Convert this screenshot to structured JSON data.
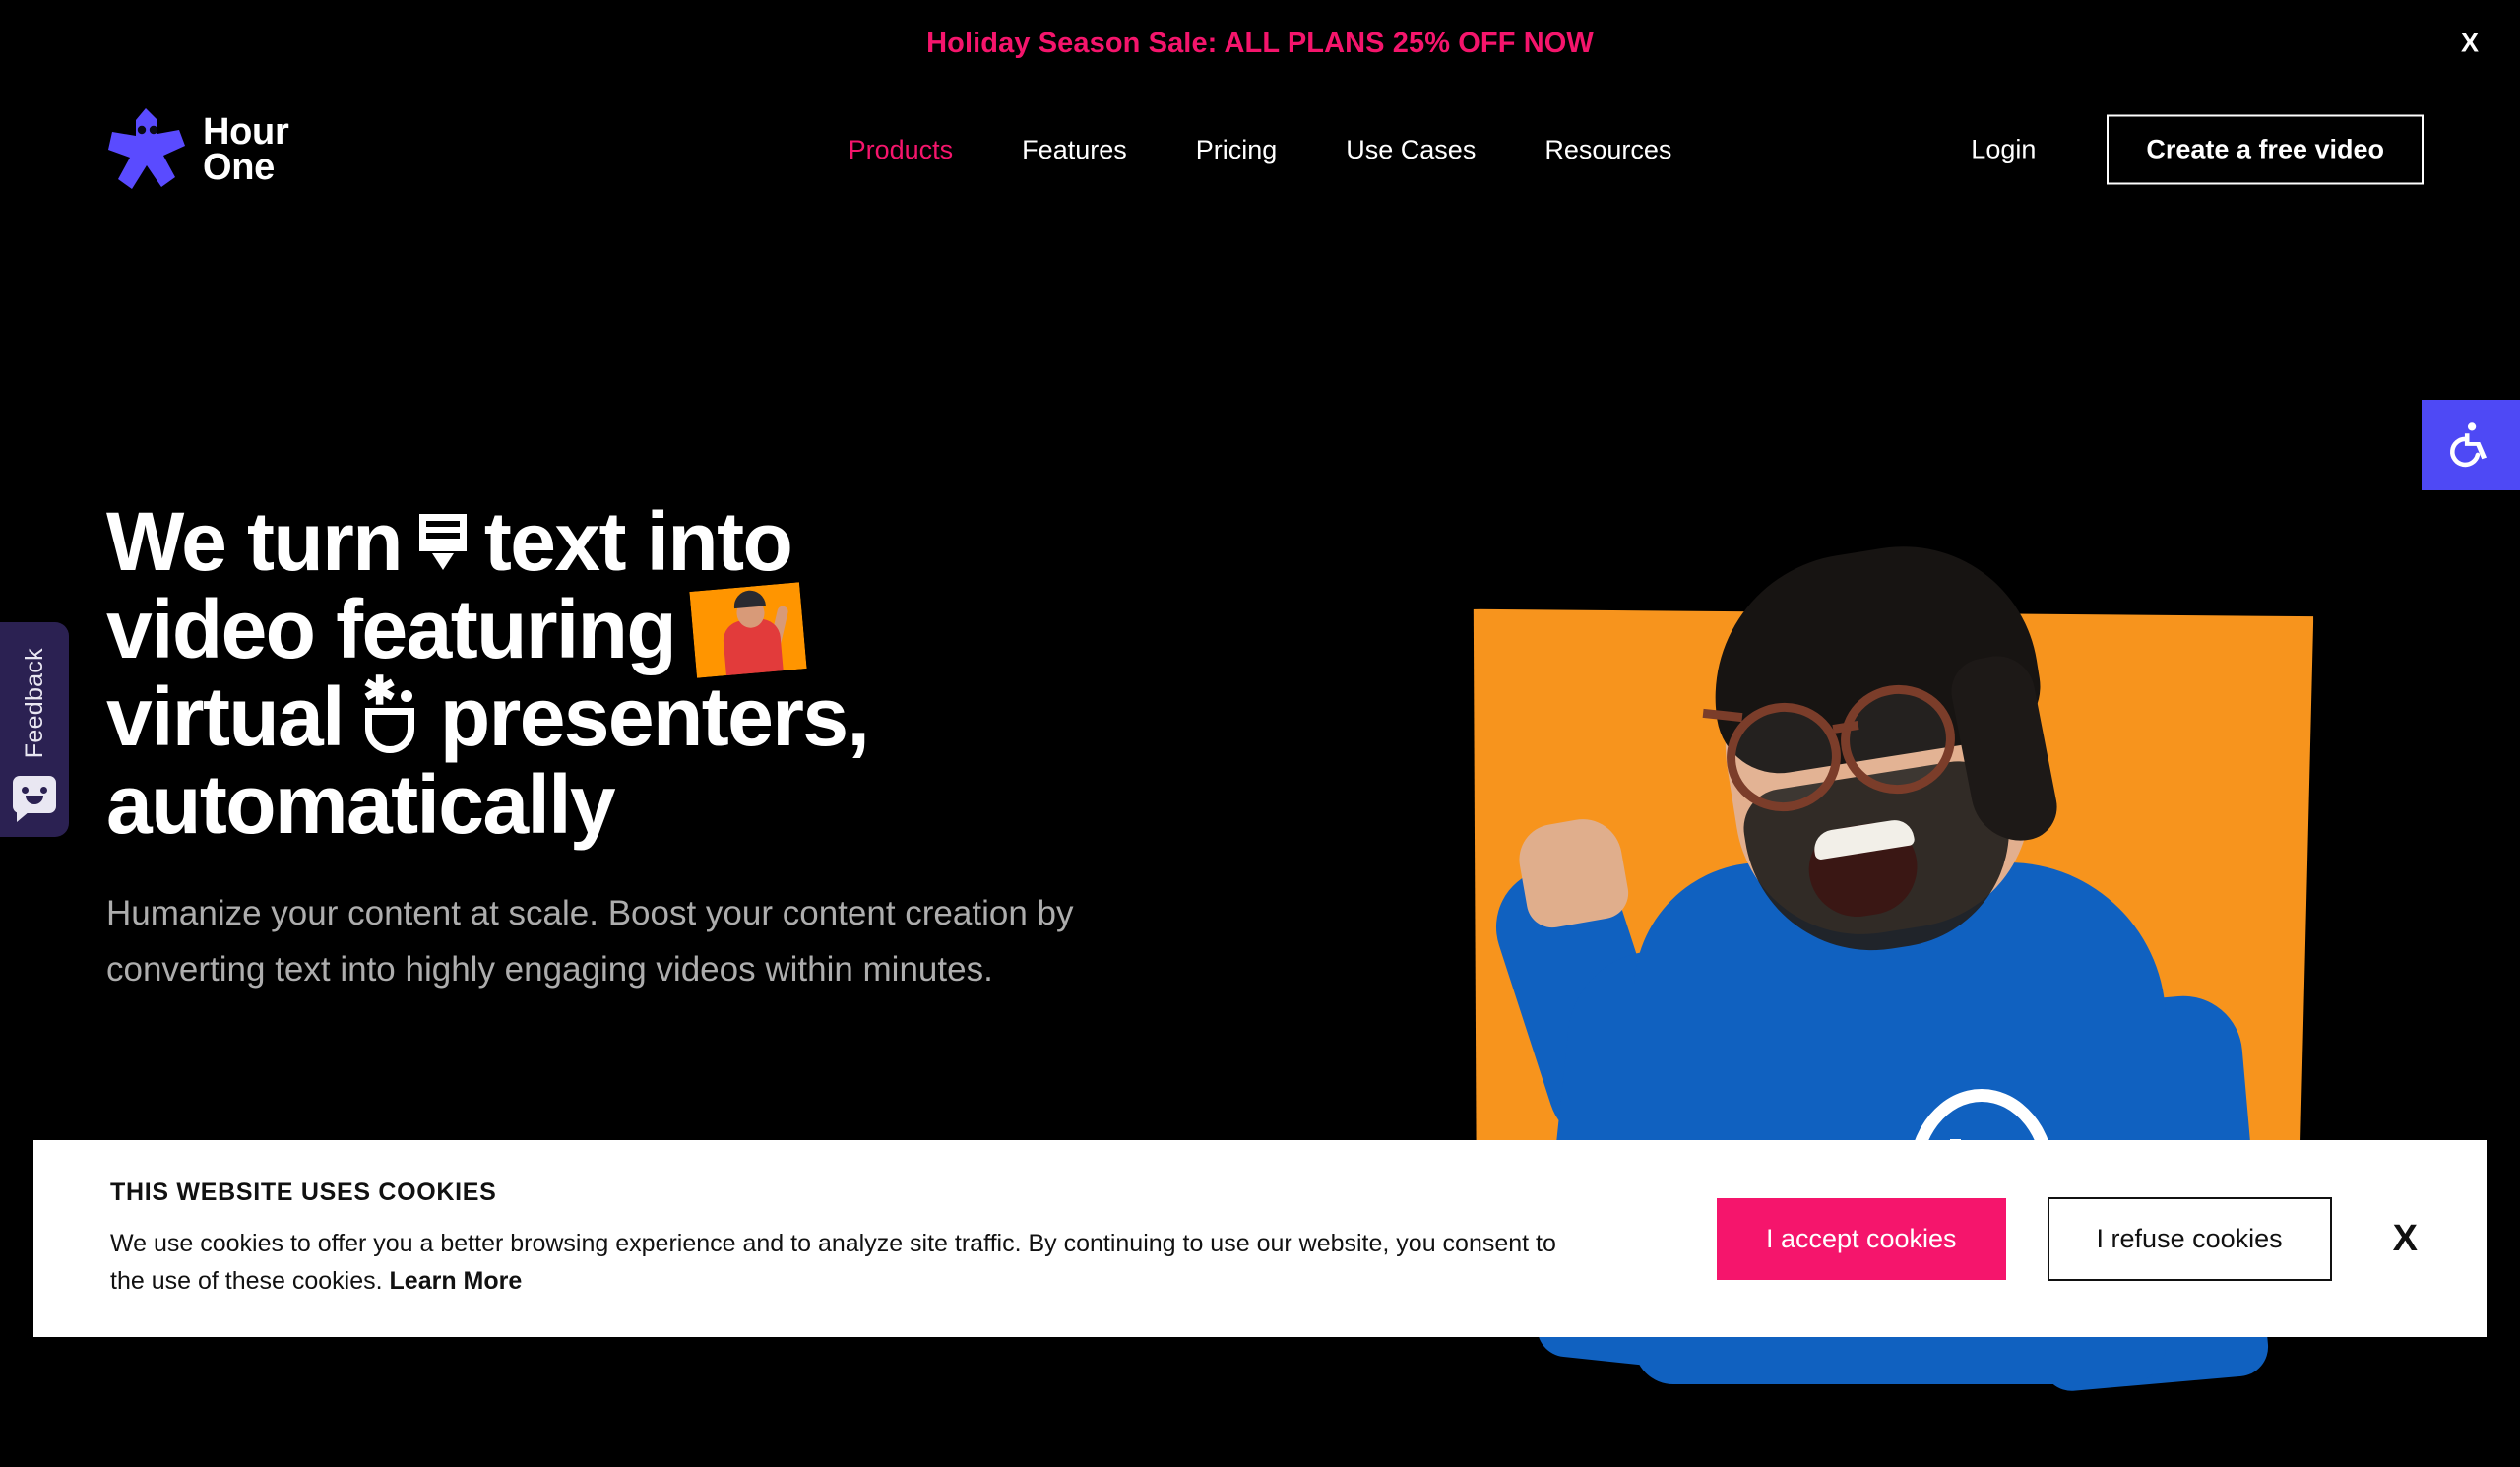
{
  "promo": {
    "text": "Holiday Season Sale: ALL PLANS 25% OFF NOW",
    "close_label": "X",
    "color": "#F5156C"
  },
  "header": {
    "logo_line1": "Hour",
    "logo_line2": "One",
    "nav": [
      {
        "label": "Products",
        "active": true
      },
      {
        "label": "Features",
        "active": false
      },
      {
        "label": "Pricing",
        "active": false
      },
      {
        "label": "Use Cases",
        "active": false
      },
      {
        "label": "Resources",
        "active": false
      }
    ],
    "login_label": "Login",
    "cta_label": "Create a free video"
  },
  "hero": {
    "headline_line1_a": "We turn",
    "headline_line1_b": "text into",
    "headline_line2": "video featuring",
    "headline_line3_a": "virtual",
    "headline_line3_b": "presenters,",
    "headline_line4": "automatically",
    "subhead": "Humanize your content at scale. Boost your content creation by converting text into highly engaging videos within minutes.",
    "icons": {
      "text_lines": "text-lines-icon",
      "presenter": "presenter-thumbnail-icon",
      "face": "smiley-face-icon",
      "play": "play-button-icon"
    },
    "art_colors": {
      "orange": "#F7941D",
      "sweater_blue": "#1061C0"
    }
  },
  "feedback": {
    "label": "Feedback",
    "icon": "speech-bubble-smiley-icon",
    "background": "#2B2152"
  },
  "accessibility": {
    "icon": "wheelchair-accessibility-icon",
    "background": "#4E49F5"
  },
  "cookies": {
    "title": "THIS WEBSITE USES COOKIES",
    "body": "We use cookies to offer you a better browsing experience and to analyze site traffic. By continuing to use our website, you consent to the use of these cookies. ",
    "learn_more": "Learn More",
    "accept_label": "I accept cookies",
    "refuse_label": "I refuse cookies",
    "close_label": "X",
    "accept_color": "#F5156C"
  }
}
